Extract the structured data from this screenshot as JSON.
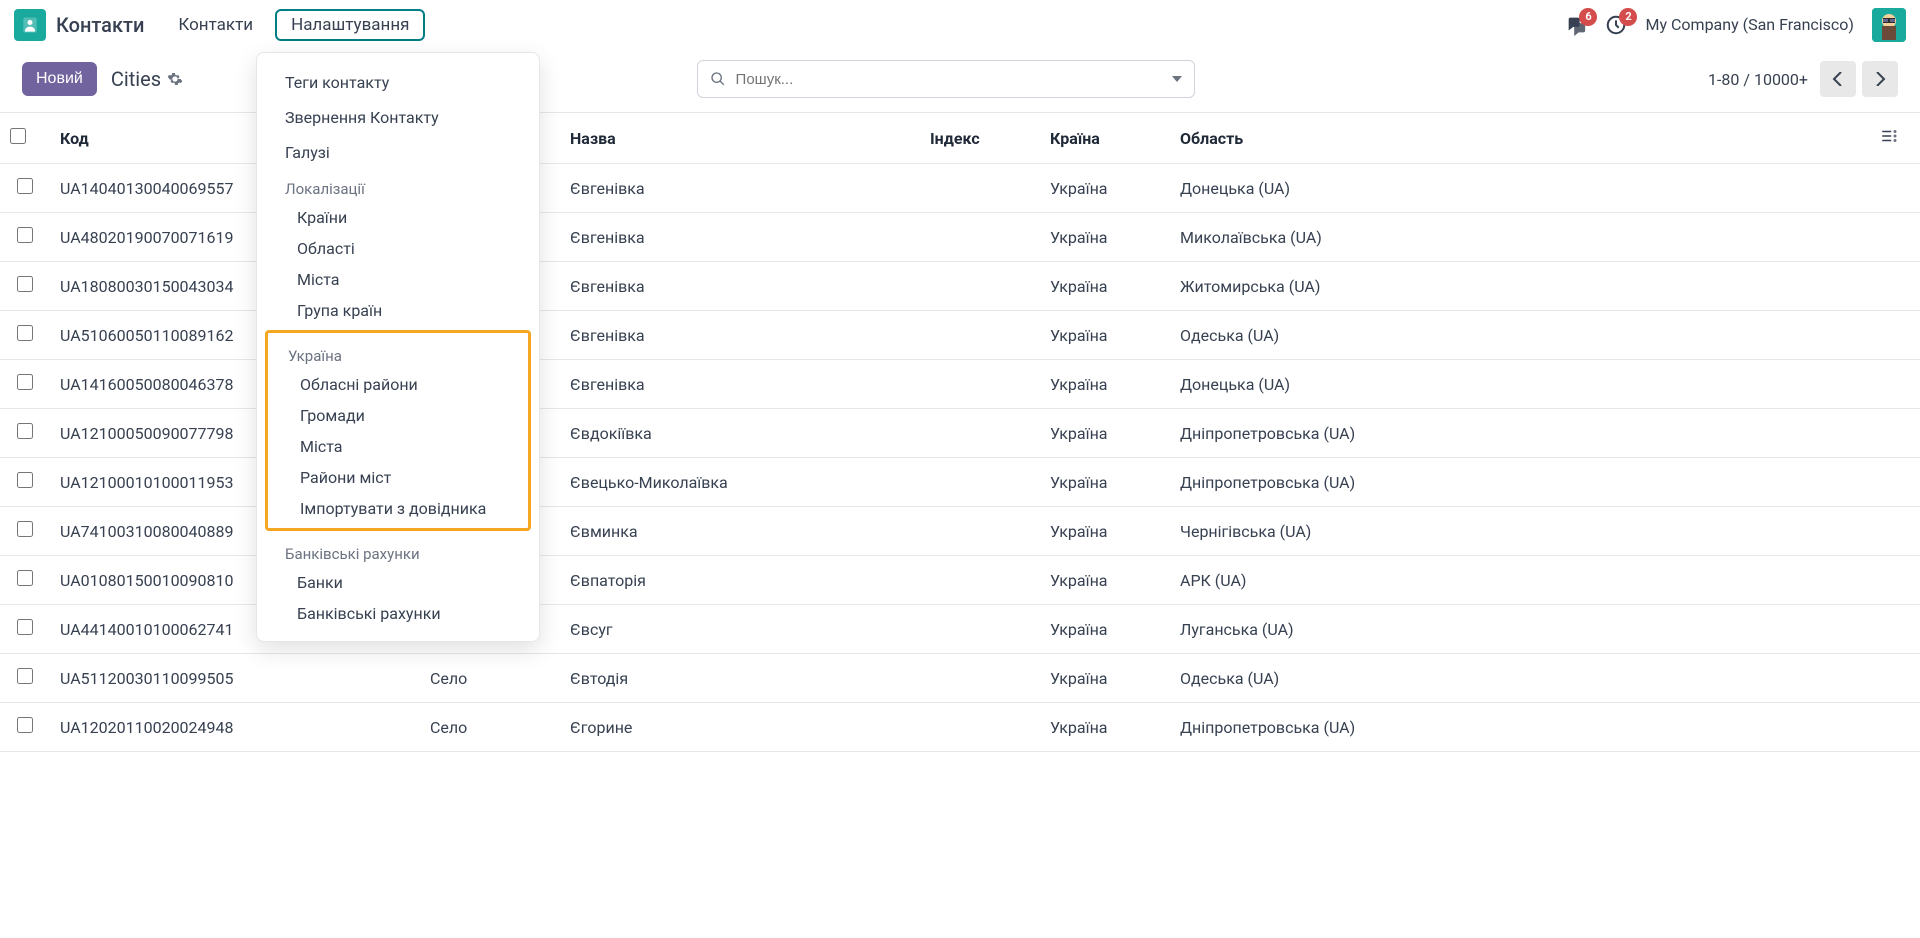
{
  "app": {
    "name": "Контакти"
  },
  "nav": {
    "contacts": "Контакти",
    "settings": "Налаштування"
  },
  "topbar": {
    "messages_badge": "6",
    "activities_badge": "2",
    "company": "My Company (San Francisco)"
  },
  "controls": {
    "new_btn": "Новий",
    "breadcrumb": "Cities",
    "search_placeholder": "Пошук...",
    "pager": "1-80 / 10000+"
  },
  "dropdown": {
    "items_top": [
      "Теги контакту",
      "Звернення Контакту",
      "Галузі"
    ],
    "loc_header": "Локалізації",
    "loc_items": [
      "Країни",
      "Області",
      "Міста",
      "Група країн"
    ],
    "ua_header": "Україна",
    "ua_items": [
      "Обласні райони",
      "Громади",
      "Міста",
      "Райони міст",
      "Імпортувати з довідника"
    ],
    "bank_header": "Банківські рахунки",
    "bank_items": [
      "Банки",
      "Банківські рахунки"
    ]
  },
  "table": {
    "headers": {
      "code": "Код",
      "name": "Назва",
      "index": "Індекс",
      "country": "Країна",
      "region": "Область"
    },
    "rows": [
      {
        "code": "UA14040130040069557",
        "type": "",
        "name": "Євгенівка",
        "index": "",
        "country": "Україна",
        "region": "Донецька (UA)"
      },
      {
        "code": "UA48020190070071619",
        "type": "",
        "name": "Євгенівка",
        "index": "",
        "country": "Україна",
        "region": "Миколаївська (UA)"
      },
      {
        "code": "UA18080030150043034",
        "type": "",
        "name": "Євгенівка",
        "index": "",
        "country": "Україна",
        "region": "Житомирська (UA)"
      },
      {
        "code": "UA51060050110089162",
        "type": "",
        "name": "Євгенівка",
        "index": "",
        "country": "Україна",
        "region": "Одеська (UA)"
      },
      {
        "code": "UA14160050080046378",
        "type": "",
        "name": "Євгенівка",
        "index": "",
        "country": "Україна",
        "region": "Донецька (UA)"
      },
      {
        "code": "UA12100050090077798",
        "type": "",
        "name": "Євдокіївка",
        "index": "",
        "country": "Україна",
        "region": "Дніпропетровська (UA)"
      },
      {
        "code": "UA12100010100011953",
        "type": "",
        "name": "Євецько-Миколаївка",
        "index": "",
        "country": "Україна",
        "region": "Дніпропетровська (UA)"
      },
      {
        "code": "UA74100310080040889",
        "type": "",
        "name": "Євминка",
        "index": "",
        "country": "Україна",
        "region": "Чернігівська (UA)"
      },
      {
        "code": "UA01080150010090810",
        "type": "",
        "name": "Євпаторія",
        "index": "",
        "country": "Україна",
        "region": "АРК (UA)"
      },
      {
        "code": "UA44140010100062741",
        "type": "",
        "name": "Євсуг",
        "index": "",
        "country": "Україна",
        "region": "Луганська (UA)"
      },
      {
        "code": "UA51120030110099505",
        "type": "Село",
        "name": "Євтодія",
        "index": "",
        "country": "Україна",
        "region": "Одеська (UA)"
      },
      {
        "code": "UA12020110020024948",
        "type": "Село",
        "name": "Єгорине",
        "index": "",
        "country": "Україна",
        "region": "Дніпропетровська (UA)"
      }
    ]
  }
}
